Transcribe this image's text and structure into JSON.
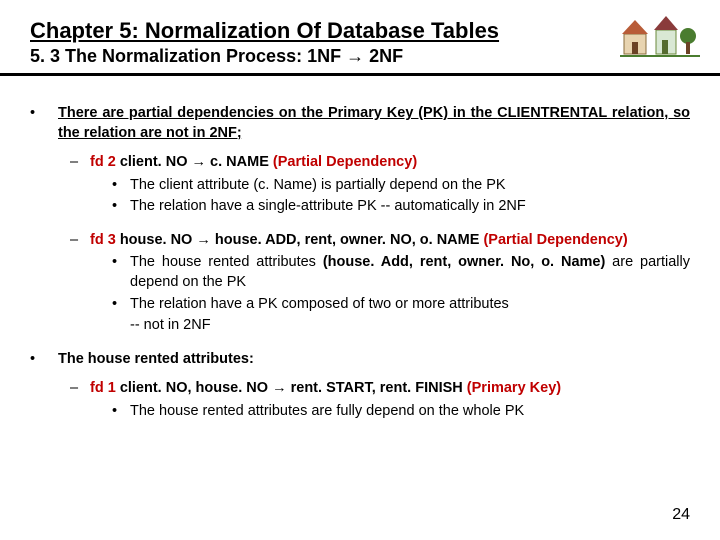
{
  "header": {
    "title": "Chapter 5: Normalization Of Database Tables",
    "subtitle_prefix": "5. 3 The Normalization Process: 1NF ",
    "subtitle_arrow": "→",
    "subtitle_suffix": " 2NF"
  },
  "point1": {
    "p1": "There are partial dependencies on the Primary Key (PK) in the ",
    "p2": "CLIENTRENTAL",
    "p3": " relation, so the relation are not in 2NF;"
  },
  "fd2": {
    "label": "fd 2 ",
    "lhs": "client. NO ",
    "arrow": "→",
    "rhs": " c. NAME ",
    "tag": "(Partial Dependency)",
    "b1": "The client attribute (c. Name) is partially depend on the PK",
    "b2": "The relation have a single-attribute PK -- automatically in 2NF"
  },
  "fd3": {
    "label": "fd 3 ",
    "lhs": "house. NO ",
    "arrow": "→",
    "rhs": " house. ADD, rent, owner. NO, o. NAME ",
    "tag": "(Partial Dependency)",
    "b1a": "The house rented attributes ",
    "b1b": "(house. Add, rent, owner. No, o. Name)",
    "b1c": " are partially depend on the PK",
    "b2": "The relation have a PK composed of two or more attributes",
    "b3": "-- not in 2NF"
  },
  "point2": {
    "text": "The house rented attributes:"
  },
  "fd1": {
    "label": "fd 1 ",
    "lhs": "client. NO, house. NO ",
    "arrow": "→",
    "rhs": " rent. START, rent. FINISH ",
    "tag": "(Primary Key)",
    "b1": "The house rented attributes are fully depend on the whole PK"
  },
  "page": "24"
}
